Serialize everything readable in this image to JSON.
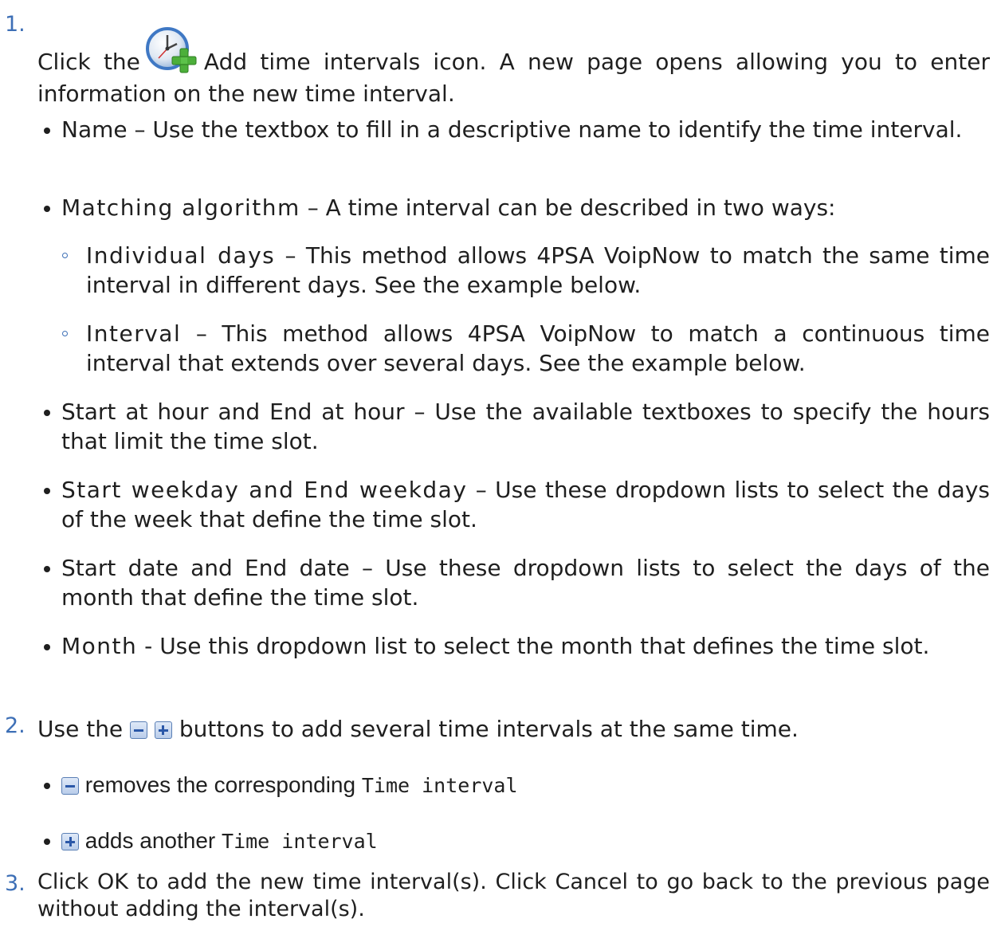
{
  "steps": [
    {
      "number": "1.",
      "text_before_icon": "Click the",
      "icon": "add-time-interval-icon",
      "text_after_icon": "Add time intervals icon. A new page opens allowing you to enter information on the new time interval."
    },
    {
      "number": "2.",
      "text_before_icons": "Use the",
      "text_after_icons": "buttons to add several time intervals at the same time."
    },
    {
      "number": "3.",
      "text": "Click OK to add the new time interval(s). Click Cancel to go back to the previous page without adding the interval(s)."
    }
  ],
  "fields": [
    {
      "term": "Name",
      "description": "Use the textbox to fill in a descriptive name to identify the time interval."
    },
    {
      "term": "Matching algorithm",
      "description": "A time interval can be described in two ways:"
    },
    {
      "term": "Start at hour and End at hour",
      "description": "Use the available textboxes to specify the hours that limit the time slot."
    },
    {
      "term": "Start weekday and End weekday",
      "description": "Use these dropdown lists to select the days of the week that define the time slot."
    },
    {
      "term": "Start date and End date",
      "description": "Use these dropdown lists to select the days of the month that define the time slot."
    },
    {
      "term": "Month",
      "description": "Use this dropdown list to select the month that defines the time slot."
    }
  ],
  "algorithms": [
    {
      "term": "Individual days",
      "description": "This method allows 4PSA VoipNow to match the same time interval in different days. See the example below."
    },
    {
      "term": "Interval",
      "description": "This method allows 4PSA VoipNow to match a continuous time interval that extends over several days. See the example below."
    }
  ],
  "buttons": [
    {
      "icon": "minus-button-icon",
      "text": "removes the corresponding",
      "code": "Time interval"
    },
    {
      "icon": "plus-button-icon",
      "text": "adds another",
      "code": "Time interval"
    }
  ],
  "separators": {
    "dash": "–",
    "hyphen": "-"
  }
}
